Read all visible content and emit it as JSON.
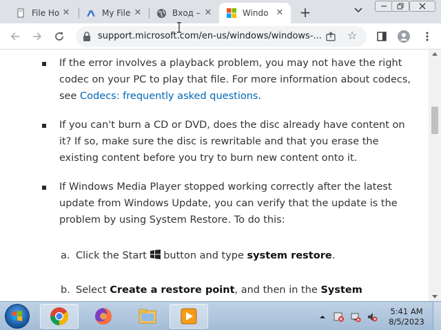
{
  "browser": {
    "tabs": [
      {
        "label": "File Ho",
        "icon": "file-icon",
        "active": false
      },
      {
        "label": "My File",
        "icon": "drive-icon",
        "active": false
      },
      {
        "label": "Вход –",
        "icon": "globe-icon",
        "active": false
      },
      {
        "label": "Windo",
        "icon": "microsoft-logo-icon",
        "active": true
      }
    ],
    "close_glyph": "✕",
    "new_tab_glyph": "+",
    "address": "support.microsoft.com/en-us/windows/windows-..."
  },
  "article": {
    "bullets": [
      {
        "text_before": "If the error involves a playback problem, you may not have the right codec on your PC to play that file. For more information about codecs, see ",
        "link": "Codecs: frequently asked questions",
        "text_after": "."
      },
      {
        "text": "If you can't burn a CD or DVD, does the disc already have content on it? If so, make sure the disc is rewritable and that you erase the existing content before you try to burn new content onto it."
      },
      {
        "text": "If Windows Media Player stopped working correctly after the latest update from Windows Update, you can verify that the update is the problem by using System Restore. To do this:"
      }
    ],
    "steps": [
      {
        "marker": "a.",
        "before": "Click the Start ",
        "middle": " button and type ",
        "bold": "system restore",
        "after": "."
      },
      {
        "marker": "b.",
        "before": "Select ",
        "bold1": "Create a restore point",
        "middle": ", and then in the ",
        "bold2": "System"
      }
    ]
  },
  "taskbar": {
    "apps": [
      "chrome-icon",
      "firefox-icon",
      "file-explorer-icon",
      "media-player-icon"
    ],
    "clock": {
      "time": "5:41 AM",
      "date": "8/5/2023"
    }
  },
  "colors": {
    "link": "#0067b8",
    "tabstrip": "#dee1e6",
    "taskbar": "#a3bcd6"
  }
}
